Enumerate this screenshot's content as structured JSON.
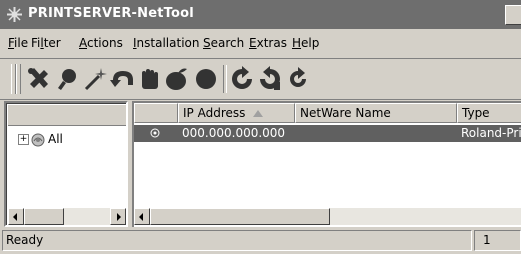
{
  "window": {
    "title": "PRINTSERVER-NetTool"
  },
  "menu": [
    {
      "id": "file",
      "accel": "F",
      "rest": "ile"
    },
    {
      "id": "filter",
      "pre": "Fi",
      "accel": "l",
      "rest": "ter"
    },
    {
      "id": "actions",
      "accel": "A",
      "rest": "ctions"
    },
    {
      "id": "installation",
      "accel": "I",
      "rest": "nstallation"
    },
    {
      "id": "search",
      "accel": "S",
      "rest": "earch"
    },
    {
      "id": "extras",
      "accel": "E",
      "rest": "xtras"
    },
    {
      "id": "help",
      "accel": "H",
      "rest": "elp"
    }
  ],
  "toolbar": {
    "icons": [
      "tools-icon",
      "search-magnifier-icon",
      "wand-icon",
      "undo-arrow-icon",
      "hand-icon",
      "apple-icon",
      "circle-icon",
      "refresh-icon",
      "refresh-back-icon",
      "reload-icon"
    ]
  },
  "tree": {
    "items": [
      {
        "label": "All",
        "expander": "+"
      }
    ]
  },
  "list": {
    "columns": [
      "",
      "IP Address",
      "NetWare Name",
      "Type"
    ],
    "rows": [
      {
        "ip": "000.000.000.000",
        "netware": "",
        "type": "Roland-Pri"
      }
    ]
  },
  "status": {
    "text": "Ready",
    "count": "1"
  },
  "colors": {
    "titlebar": "#6e6e6e",
    "selection": "#606060",
    "face": "#d4d0c8"
  }
}
